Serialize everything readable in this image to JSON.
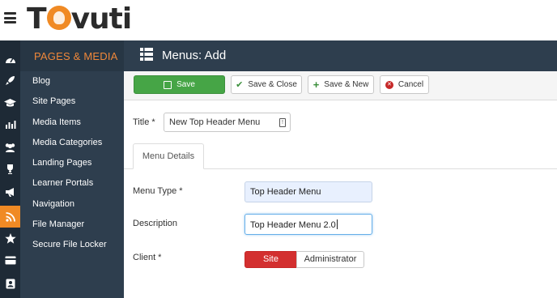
{
  "header": {
    "logo_text_left": "T",
    "logo_text_right": "vuti"
  },
  "rail": {
    "icons": [
      "dashboard-icon",
      "rocket-icon",
      "graduation-cap-icon",
      "bar-chart-icon",
      "users-icon",
      "trophy-icon",
      "megaphone-icon",
      "feed-icon",
      "star-icon",
      "credit-card-icon",
      "id-badge-icon"
    ],
    "active_index": 7,
    "accent_color": "#f08a24"
  },
  "sidebar": {
    "heading": "PAGES & MEDIA",
    "items": [
      {
        "label": "Blog"
      },
      {
        "label": "Site Pages"
      },
      {
        "label": "Media Items"
      },
      {
        "label": "Media Categories"
      },
      {
        "label": "Landing Pages"
      },
      {
        "label": "Learner Portals"
      },
      {
        "label": "Navigation"
      },
      {
        "label": "File Manager"
      },
      {
        "label": "Secure File Locker"
      }
    ]
  },
  "page": {
    "title": "Menus: Add"
  },
  "toolbar": {
    "save_label": "Save",
    "save_close_label": "Save & Close",
    "save_new_label": "Save & New",
    "cancel_label": "Cancel"
  },
  "form": {
    "title_label": "Title *",
    "title_value": "New Top Header Menu",
    "tab_label": "Menu Details",
    "menu_type_label": "Menu Type *",
    "menu_type_value": "Top Header Menu",
    "description_label": "Description",
    "description_value": "Top Header Menu 2.0",
    "client_label": "Client *",
    "client_options": [
      "Site",
      "Administrator"
    ],
    "client_selected": "Site"
  },
  "colors": {
    "save_green": "#46a546",
    "site_red": "#d32f2f",
    "sidebar_accent": "#f0883a",
    "navy": "#2e3e4e"
  }
}
